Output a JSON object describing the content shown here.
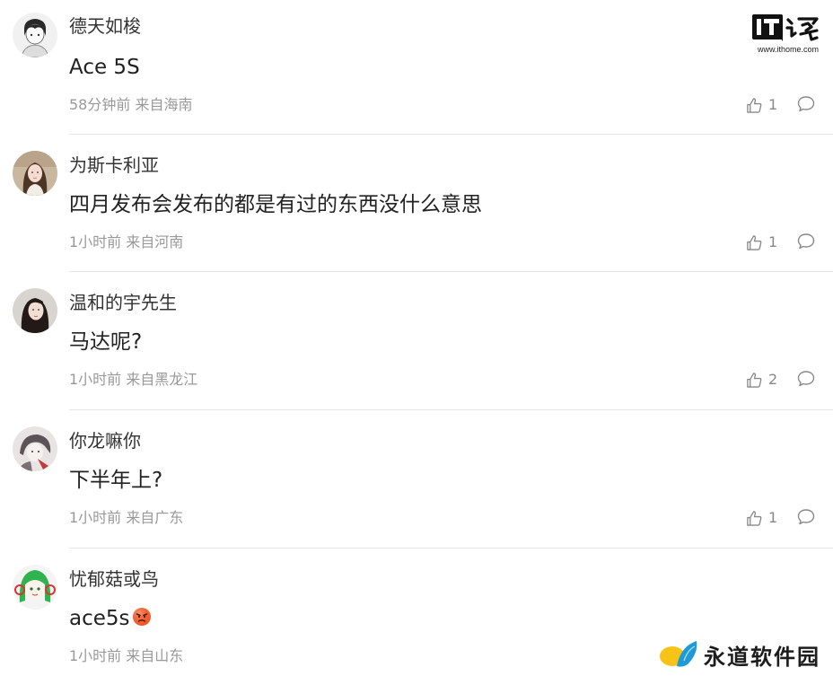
{
  "brand": {
    "logo_text": "IT之家",
    "url": "www.ithome.com"
  },
  "watermark": {
    "text": "永道软件园"
  },
  "comments": [
    {
      "username": "德天如梭",
      "content": "Ace 5S",
      "meta": "58分钟前 来自海南",
      "likes": "1",
      "avatar_icon": "cartoon-boy-avatar"
    },
    {
      "username": "为斯卡利亚",
      "content": "四月发布会发布的都是有过的东西没什么意思",
      "meta": "1小时前 来自河南",
      "likes": "1",
      "avatar_icon": "girl-photo-avatar"
    },
    {
      "username": "温和的宇先生",
      "content": "马达呢?",
      "meta": "1小时前 来自黑龙江",
      "likes": "2",
      "avatar_icon": "woman-photo-avatar"
    },
    {
      "username": "你龙嘛你",
      "content": "下半年上?",
      "meta": "1小时前 来自广东",
      "likes": "1",
      "avatar_icon": "anime-character-avatar"
    },
    {
      "username": "忧郁菇或鸟",
      "content": "ace5s",
      "meta": "1小时前 来自山东",
      "likes": "",
      "avatar_icon": "green-hair-anime-avatar",
      "content_emoji": "angry-face-emoji"
    }
  ]
}
